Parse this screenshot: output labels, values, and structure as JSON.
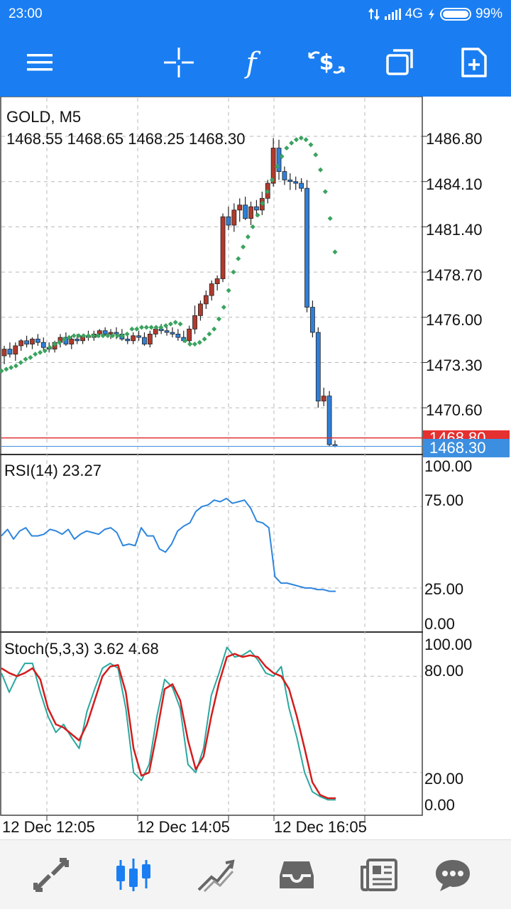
{
  "status_bar": {
    "time": "23:00",
    "network": "4G",
    "battery": "99%",
    "icons": [
      "data-transfer-icon",
      "signal-icon",
      "charging-icon",
      "battery-icon"
    ]
  },
  "toolbar": {
    "buttons": [
      {
        "name": "menu",
        "icon": "hamburger-menu-icon"
      },
      {
        "name": "crosshair",
        "icon": "crosshair-icon"
      },
      {
        "name": "indicators",
        "icon": "function-icon"
      },
      {
        "name": "trade",
        "icon": "trade-dollar-icon"
      },
      {
        "name": "windows",
        "icon": "window-stack-icon"
      },
      {
        "name": "new-order",
        "icon": "document-add-icon"
      }
    ]
  },
  "main_chart": {
    "symbol_label": "GOLD, M5",
    "ohlc": "1468.55 1468.65 1468.25 1468.30",
    "price_labels": [
      "1486.80",
      "1484.10",
      "1481.40",
      "1478.70",
      "1476.00",
      "1473.30",
      "1470.60"
    ],
    "bid_label": "1468.80",
    "last_price_label": "1468.30",
    "colors": {
      "bull": "#b13a2c",
      "bear": "#2f7fd8",
      "sar": "#3aa35e",
      "ask_line": "#e03030",
      "bid_line": "#3c8fe0"
    }
  },
  "rsi": {
    "label": "RSI(14) 23.27",
    "levels": [
      "100.00",
      "75.00",
      "25.00",
      "0.00"
    ],
    "color": "#2e86de"
  },
  "stoch": {
    "label": "Stoch(5,3,3) 3.62 4.68",
    "levels": [
      "100.00",
      "80.00",
      "20.00",
      "0.00"
    ],
    "main_color": "#2aa7a0",
    "signal_color": "#d41c1c"
  },
  "time_axis": {
    "labels": [
      "12 Dec 12:05",
      "12 Dec 14:05",
      "12 Dec 16:05"
    ]
  },
  "bottom_nav": {
    "items": [
      {
        "name": "quotes",
        "icon": "quotes-arrows-icon",
        "active": false
      },
      {
        "name": "charts",
        "icon": "candlestick-icon",
        "active": true
      },
      {
        "name": "trade",
        "icon": "trade-trend-icon",
        "active": false
      },
      {
        "name": "history",
        "icon": "inbox-icon",
        "active": false
      },
      {
        "name": "news",
        "icon": "newspaper-icon",
        "active": false
      },
      {
        "name": "messages",
        "icon": "chat-bubble-icon",
        "active": false
      }
    ]
  },
  "chart_data": [
    {
      "type": "candlestick",
      "title": "GOLD, M5",
      "xlabel": "",
      "ylabel": "",
      "ylim": [
        1468.0,
        1488.0
      ],
      "x_ticks": [
        "12 Dec 12:05",
        "12 Dec 14:05",
        "12 Dec 16:05"
      ],
      "y_ticks": [
        1486.8,
        1484.1,
        1481.4,
        1478.7,
        1476.0,
        1473.3,
        1470.6
      ],
      "candles": [
        [
          1473.7,
          1474.3,
          1473.2,
          1474.1
        ],
        [
          1474.1,
          1474.5,
          1473.6,
          1473.8
        ],
        [
          1473.8,
          1474.5,
          1473.4,
          1474.3
        ],
        [
          1474.3,
          1474.7,
          1474.0,
          1474.6
        ],
        [
          1474.6,
          1474.9,
          1474.2,
          1474.4
        ],
        [
          1474.4,
          1474.8,
          1474.1,
          1474.7
        ],
        [
          1474.7,
          1475.0,
          1474.3,
          1474.5
        ],
        [
          1474.5,
          1474.8,
          1474.0,
          1474.2
        ],
        [
          1474.2,
          1474.5,
          1473.9,
          1474.1
        ],
        [
          1474.1,
          1474.6,
          1473.9,
          1474.5
        ],
        [
          1474.5,
          1475.0,
          1474.2,
          1474.8
        ],
        [
          1474.8,
          1475.1,
          1474.3,
          1474.4
        ],
        [
          1474.4,
          1474.9,
          1474.1,
          1474.7
        ],
        [
          1474.7,
          1475.0,
          1474.4,
          1474.6
        ],
        [
          1474.6,
          1475.0,
          1474.4,
          1474.9
        ],
        [
          1474.9,
          1475.2,
          1474.6,
          1474.8
        ],
        [
          1474.8,
          1475.2,
          1474.6,
          1475.0
        ],
        [
          1475.0,
          1475.3,
          1474.8,
          1475.2
        ],
        [
          1475.2,
          1475.4,
          1474.9,
          1475.0
        ],
        [
          1475.0,
          1475.3,
          1474.7,
          1475.1
        ],
        [
          1475.1,
          1475.4,
          1474.7,
          1475.0
        ],
        [
          1475.0,
          1475.3,
          1474.6,
          1474.7
        ],
        [
          1474.7,
          1475.0,
          1474.4,
          1474.6
        ],
        [
          1474.6,
          1475.1,
          1474.4,
          1474.9
        ],
        [
          1474.9,
          1475.2,
          1474.6,
          1474.8
        ],
        [
          1474.8,
          1475.1,
          1474.3,
          1474.4
        ],
        [
          1474.4,
          1475.2,
          1474.2,
          1475.0
        ],
        [
          1475.0,
          1475.5,
          1474.8,
          1475.3
        ],
        [
          1475.3,
          1475.6,
          1475.0,
          1475.2
        ],
        [
          1475.2,
          1475.5,
          1474.9,
          1475.1
        ],
        [
          1475.1,
          1475.4,
          1474.8,
          1475.0
        ],
        [
          1475.0,
          1475.3,
          1474.6,
          1474.8
        ],
        [
          1474.8,
          1475.2,
          1474.5,
          1474.6
        ],
        [
          1474.6,
          1475.5,
          1474.4,
          1475.3
        ],
        [
          1475.3,
          1476.7,
          1475.0,
          1476.1
        ],
        [
          1476.1,
          1477.0,
          1475.8,
          1476.8
        ],
        [
          1476.8,
          1477.6,
          1476.5,
          1477.3
        ],
        [
          1477.3,
          1478.2,
          1477.0,
          1478.0
        ],
        [
          1478.0,
          1478.5,
          1477.6,
          1478.3
        ],
        [
          1478.3,
          1482.2,
          1478.1,
          1482.0
        ],
        [
          1482.0,
          1482.6,
          1481.2,
          1481.5
        ],
        [
          1481.5,
          1482.8,
          1481.1,
          1482.4
        ],
        [
          1482.4,
          1483.1,
          1481.7,
          1482.7
        ],
        [
          1482.7,
          1483.2,
          1481.8,
          1481.9
        ],
        [
          1481.9,
          1482.9,
          1481.5,
          1482.6
        ],
        [
          1482.6,
          1483.0,
          1482.0,
          1482.4
        ],
        [
          1482.4,
          1483.5,
          1482.1,
          1483.1
        ],
        [
          1483.1,
          1484.2,
          1482.8,
          1484.0
        ],
        [
          1484.0,
          1486.7,
          1483.8,
          1486.1
        ],
        [
          1486.1,
          1486.6,
          1484.2,
          1484.7
        ],
        [
          1484.7,
          1485.0,
          1483.9,
          1484.2
        ],
        [
          1484.2,
          1484.6,
          1483.6,
          1484.1
        ],
        [
          1484.1,
          1484.4,
          1483.6,
          1484.0
        ],
        [
          1484.0,
          1484.3,
          1483.5,
          1483.7
        ],
        [
          1483.7,
          1484.2,
          1476.3,
          1476.6
        ],
        [
          1476.6,
          1477.0,
          1474.8,
          1475.1
        ],
        [
          1475.1,
          1475.4,
          1470.6,
          1471.0
        ],
        [
          1471.0,
          1471.8,
          1470.7,
          1471.3
        ],
        [
          1471.3,
          1471.6,
          1468.3,
          1468.4
        ],
        [
          1468.4,
          1468.65,
          1468.25,
          1468.3
        ]
      ],
      "parabolic_sar": [
        1472.8,
        1472.9,
        1473.0,
        1473.1,
        1473.3,
        1473.5,
        1473.6,
        1473.8,
        1473.9,
        1474.0,
        1474.2,
        1474.4,
        1474.5,
        1474.7,
        1474.8,
        1474.9,
        1474.9,
        1474.9,
        1474.9,
        1474.9,
        1474.9,
        1474.9,
        1474.9,
        1474.9,
        1474.9,
        1474.9,
        1475.0,
        1475.3,
        1475.3,
        1475.4,
        1475.4,
        1475.4,
        1475.4,
        1475.4,
        1475.5,
        1475.6,
        1475.7,
        1475.6,
        1474.6,
        1474.4,
        1474.4,
        1474.5,
        1474.7,
        1475.0,
        1475.3,
        1475.9,
        1476.6,
        1477.6,
        1478.7,
        1479.5,
        1480.2,
        1480.8,
        1481.4,
        1482.1,
        1482.8,
        1483.5,
        1484.2,
        1485.0,
        1485.6,
        1486.1,
        1486.4,
        1486.6,
        1486.7,
        1486.6,
        1486.3,
        1485.7,
        1484.8,
        1483.5,
        1481.9,
        1479.9
      ]
    },
    {
      "type": "line",
      "title": "RSI(14) 23.27",
      "ylim": [
        0,
        100
      ],
      "y_ticks": [
        100,
        75,
        25,
        0
      ],
      "series": [
        {
          "values": [
            57,
            61,
            55,
            60,
            62,
            57,
            57,
            58,
            61,
            60,
            58,
            61,
            55,
            58,
            60,
            59,
            58,
            61,
            62,
            59,
            51,
            52,
            51,
            62,
            57,
            57,
            49,
            47,
            52,
            60,
            63,
            65,
            72,
            75,
            76,
            79,
            78,
            80,
            77,
            78,
            79,
            74,
            66,
            65,
            62,
            32,
            28,
            28,
            27,
            26,
            25,
            25,
            24,
            24,
            23,
            23
          ]
        }
      ]
    },
    {
      "type": "line",
      "title": "Stoch(5,3,3) 3.62 4.68",
      "ylim": [
        0,
        100
      ],
      "y_ticks": [
        100,
        80,
        20,
        0
      ],
      "series": [
        {
          "values": [
            82,
            70,
            80,
            88,
            88,
            70,
            55,
            45,
            50,
            42,
            35,
            58,
            72,
            85,
            88,
            85,
            60,
            20,
            15,
            25,
            55,
            78,
            73,
            60,
            25,
            20,
            35,
            68,
            82,
            98,
            92,
            93,
            96,
            90,
            82,
            80,
            86,
            60,
            42,
            20,
            8,
            5,
            3,
            3
          ]
        },
        {
          "values": [
            85,
            82,
            80,
            82,
            85,
            78,
            60,
            50,
            48,
            44,
            40,
            50,
            65,
            80,
            86,
            87,
            70,
            35,
            18,
            20,
            45,
            72,
            75,
            65,
            40,
            22,
            30,
            55,
            76,
            92,
            94,
            92,
            93,
            92,
            86,
            82,
            80,
            72,
            55,
            35,
            14,
            6,
            4,
            4
          ]
        }
      ]
    }
  ]
}
